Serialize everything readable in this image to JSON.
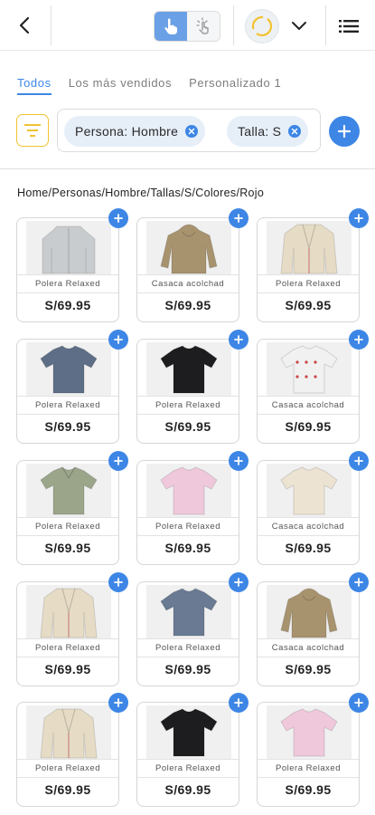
{
  "header": {
    "back_icon": "chevron-left-icon",
    "mode_active_icon": "hand-pointer-icon",
    "mode_inactive_icon": "tap-sparkle-icon",
    "avatar_icon": "ring-avatar-icon",
    "dropdown_icon": "chevron-down-icon",
    "menu_icon": "list-menu-icon"
  },
  "tabs": [
    {
      "label": "Todos",
      "active": true
    },
    {
      "label": "Los más vendidos",
      "active": false
    },
    {
      "label": "Personalizado 1",
      "active": false
    }
  ],
  "filters": {
    "chips": [
      {
        "label": "Persona: Hombre"
      },
      {
        "label": "Talla: S"
      }
    ]
  },
  "breadcrumb": "Home/Personas/Hombre/Tallas/S/Colores/Rojo",
  "products": [
    {
      "name": "Polera Relaxed",
      "price": "S/69.95",
      "garment": "jacket",
      "color": "#c9ccce"
    },
    {
      "name": "Casaca acolchad",
      "price": "S/69.95",
      "garment": "hoodie",
      "color": "#a8936f"
    },
    {
      "name": "Polera Relaxed",
      "price": "S/69.95",
      "garment": "blazer",
      "color": "#e6dcc6"
    },
    {
      "name": "Polera Relaxed",
      "price": "S/69.95",
      "garment": "tshirt",
      "color": "#5e6e87"
    },
    {
      "name": "Polera Relaxed",
      "price": "S/69.95",
      "garment": "tshirt",
      "color": "#1d1d1f"
    },
    {
      "name": "Casaca acolchad",
      "price": "S/69.95",
      "garment": "shirt",
      "color": "#f1f1f1"
    },
    {
      "name": "Polera Relaxed",
      "price": "S/69.95",
      "garment": "polo",
      "color": "#9aa58a"
    },
    {
      "name": "Polera Relaxed",
      "price": "S/69.95",
      "garment": "tshirt",
      "color": "#f0c8dc"
    },
    {
      "name": "Casaca acolchad",
      "price": "S/69.95",
      "garment": "tshirt",
      "color": "#ece3d3"
    },
    {
      "name": "Polera Relaxed",
      "price": "S/69.95",
      "garment": "blazer",
      "color": "#e6dcc6"
    },
    {
      "name": "Polera Relaxed",
      "price": "S/69.95",
      "garment": "tshirt",
      "color": "#6a7a93"
    },
    {
      "name": "Casaca acolchad",
      "price": "S/69.95",
      "garment": "hoodie",
      "color": "#a8936f"
    },
    {
      "name": "Polera Relaxed",
      "price": "S/69.95",
      "garment": "blazer",
      "color": "#e6dcc6"
    },
    {
      "name": "Polera Relaxed",
      "price": "S/69.95",
      "garment": "tshirt",
      "color": "#1d1d1f"
    },
    {
      "name": "Polera Relaxed",
      "price": "S/69.95",
      "garment": "tshirt",
      "color": "#f0c8dc"
    }
  ],
  "colors": {
    "accent": "#3d86e6",
    "filter_border": "#f2c230",
    "chip_bg": "#e6eef8"
  }
}
